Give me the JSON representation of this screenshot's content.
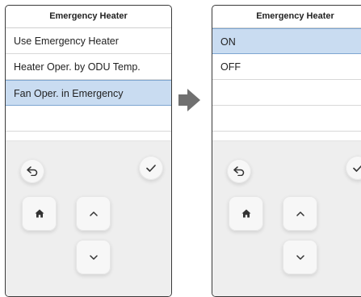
{
  "left_panel": {
    "title": "Emergency Heater",
    "items": [
      {
        "label": "Use Emergency Heater"
      },
      {
        "label": "Heater Oper. by ODU Temp."
      },
      {
        "label": "Fan Oper. in Emergency",
        "selected": true
      },
      {
        "label": ""
      },
      {
        "label": ""
      }
    ]
  },
  "right_panel": {
    "title": "Emergency Heater",
    "items": [
      {
        "label": "ON",
        "selected": true,
        "checked": true
      },
      {
        "label": "OFF"
      },
      {
        "label": ""
      },
      {
        "label": ""
      },
      {
        "label": ""
      }
    ]
  },
  "keypad": {
    "back_icon": "back-arrow-icon",
    "confirm_icon": "check-icon",
    "home_icon": "home-icon",
    "up_icon": "chevron-up-icon",
    "down_icon": "chevron-down-icon"
  },
  "colors": {
    "selected_row": "#c9dcf1",
    "selected_border": "#7ea6d1",
    "arrow": "#707070",
    "keypad_bg": "#eeeeee"
  }
}
